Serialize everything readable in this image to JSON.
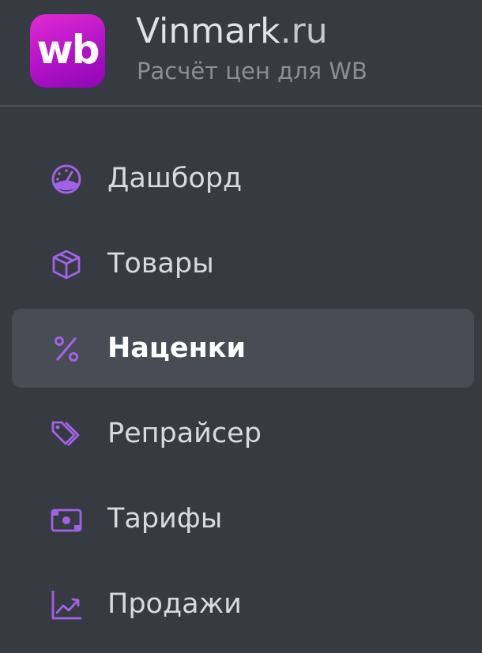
{
  "header": {
    "logo_text": "wb",
    "brand_name": "Vinmark",
    "brand_domain": ".ru",
    "tagline": "Расчёт цен для WB"
  },
  "colors": {
    "background": "#363a41",
    "active_item": "#484d55",
    "icon_accent": "#a362e6",
    "logo_gradient_start": "#e02bd0",
    "logo_gradient_end": "#8c06b3"
  },
  "sidebar": {
    "items": [
      {
        "label": "Дашборд",
        "icon": "speedometer-icon",
        "active": false
      },
      {
        "label": "Товары",
        "icon": "box-icon",
        "active": false
      },
      {
        "label": "Наценки",
        "icon": "percent-icon",
        "active": true
      },
      {
        "label": "Репрайсер",
        "icon": "tags-icon",
        "active": false
      },
      {
        "label": "Тарифы",
        "icon": "banknote-icon",
        "active": false
      },
      {
        "label": "Продажи",
        "icon": "trending-up-icon",
        "active": false
      }
    ]
  }
}
